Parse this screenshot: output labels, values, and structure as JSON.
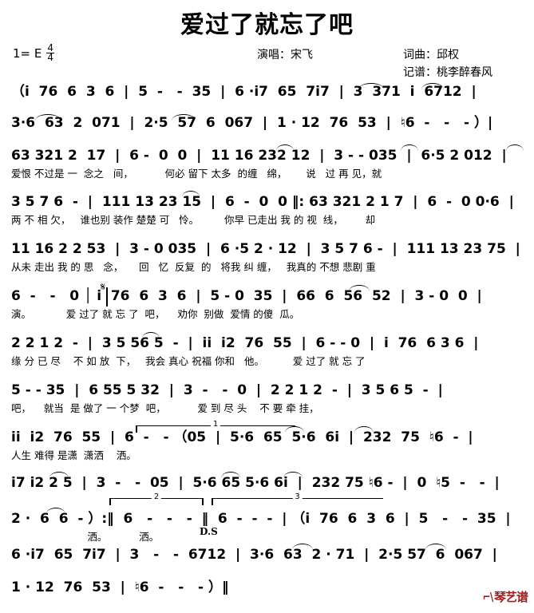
{
  "header": {
    "title": "爱过了就忘了吧",
    "key_label": "1= E",
    "time_num": "4",
    "time_den": "4",
    "singer": "演唱：宋飞",
    "credit_composer": "词曲：邱权",
    "credit_transcriber": "记谱：桃李醉春风"
  },
  "logo": {
    "text": "琴艺谱",
    "color": "#9c1b1b"
  },
  "marks": {
    "segno": "𝄋",
    "ds": "D.S",
    "volta1": "1",
    "volta2": "2",
    "volta3": "3"
  },
  "systems": [
    {
      "id": "sys-1",
      "notes": "（i  76  6  3  6  |  5  -   -  35  |  6 ·i7  65  7i7  |  3  371  i  6712  |",
      "lyrics": ""
    },
    {
      "id": "sys-2",
      "notes": "3·6  63  2  071  |  2·5  57  6  067  |  1 · 12  76  53  |  ♮6  -   -   - ）|",
      "lyrics": ""
    },
    {
      "id": "sys-3",
      "notes": "63 321 2  17  |  6 -  0  0  |  11 16 232 12  |  3 - - 035  |  6·5 2 012  |",
      "lyrics": "爱恨 不过是 一  念之   间，          何必 留下 太多  的缠   绵，      说   过 再 见，就"
    },
    {
      "id": "sys-4",
      "notes": "3 5 7 6  -  |  111 13 23 15  |  6  -  0  0 ‖: 63 321 2 1 7  |  6  -  0 0·6  |",
      "lyrics": "两 不 相 欠，   谁也别 装作 楚楚 可   怜。        你早 已走出 我 的 视  线，       却"
    },
    {
      "id": "sys-5",
      "notes": "11 16 2 2 53  |  3 - 0 035  |  6 ·5 2 · 12  |  3 5 7 6 -  |  111 13 23 75  |",
      "lyrics": "从未 走出 我 的 思   念，     回   忆  反复  的   将我 纠 缠，   我真的 不想 悲剧 重"
    },
    {
      "id": "sys-6",
      "notes": "6  -   -   0 │ i  76  6  3  6  |  5 - 0  35  |  66  6  56  52  |  3 - 0  0  |",
      "lyrics": "演。           爱 过了 就 忘 了  吧，    劝你  别做  爱情 的傻  瓜。"
    },
    {
      "id": "sys-7",
      "notes": "2 2 1 2  -  |  3 5 56 5  -  |  ii  i2  76  55  |  6 - - 0  |  i  76  6 3 6  |",
      "lyrics": "缘 分 已 尽    不 如 放  下，   我会 真心 祝福 你和   他。         爱 过了 就 忘 了"
    },
    {
      "id": "sys-8",
      "notes": "5 - - 35  |  6 55 5 32  |  3  -   -  0  |  2 2 1 2  -  |  3 5 6 5  -  |",
      "lyrics": "吧，    就当  是 做了 一 个梦  吧，          爱 到 尽 头    不 要 牵 挂，"
    },
    {
      "id": "sys-9",
      "notes": "ii  i2  76  55  |  6  -   - （05  |  5·6  65  5·6  6i  |  232  75  ♮6  -  |",
      "lyrics": "人生 难得 是潇  潇洒    洒。"
    },
    {
      "id": "sys-10",
      "notes": "i7 i2 2 5  |  3  -   -  05  |  5·6 65 5·6 6i  |  232 75 ♮6 -  |  0  ♮5  -   -  |",
      "lyrics": ""
    },
    {
      "id": "sys-11",
      "notes": "2 ·  6  6  - ）:‖  6   -   -   -  ‖  6  -  -  -  | （i  76  6  3  6  |  5   -   -  35  |",
      "lyrics": "                        洒。          洒。"
    },
    {
      "id": "sys-12",
      "notes": "6 ·i7  65  7i7  |  3   -   -  6712  |  3·6  63  2 · 71  |  2·5 57  6  067  |",
      "lyrics": ""
    },
    {
      "id": "sys-13",
      "notes": "1 · 12  76  53  |  ♮6  -   -   - ）‖",
      "lyrics": ""
    }
  ],
  "music_content": {
    "description": "Jianpu (numbered musical notation) score, 4/4 time, key of E",
    "lyrics_full": [
      "爱恨不过是一念之间，何必留下太多的缠绵，说过再见，就两不相欠，谁也别装作楚楚可怜。",
      "你早已走出我的视线，却从未走出我的思念，回忆反复的将我纠缠，我真的不想悲剧重演。",
      "爱过了就忘了吧，劝你别做爱情的傻瓜。",
      "缘分已尽不如放下，我会真心祝福你和他。",
      "爱过了就忘了吧，就当是做了一个梦吧，",
      "爱到尽头不要牵挂，人生难得是潇潇洒洒。",
      "洒。洒。"
    ]
  }
}
